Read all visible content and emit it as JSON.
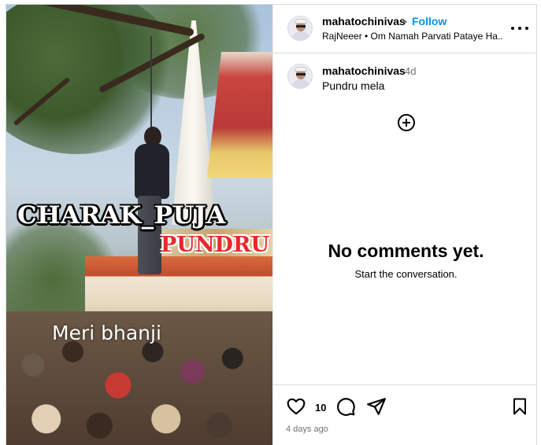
{
  "media": {
    "overlay_line1": "CHARAK_PUJA",
    "overlay_line2": "PUNDRU",
    "overlay_line3": "Meri bhanji"
  },
  "header": {
    "username": "mahatochinivas",
    "separator": "•",
    "follow_label": "Follow",
    "subline": "RajNeeer • Om Namah Parvati Pataye Ha..."
  },
  "caption": {
    "username": "mahatochinivas",
    "time": "4d",
    "text": "Pundru mela"
  },
  "comments": {
    "empty_title": "No comments yet.",
    "empty_subtitle": "Start the conversation."
  },
  "footer": {
    "like_count": "10",
    "date": "4 days ago"
  },
  "icons": [
    "more-icon",
    "add-icon",
    "heart-icon",
    "comment-icon",
    "share-icon",
    "bookmark-icon"
  ]
}
